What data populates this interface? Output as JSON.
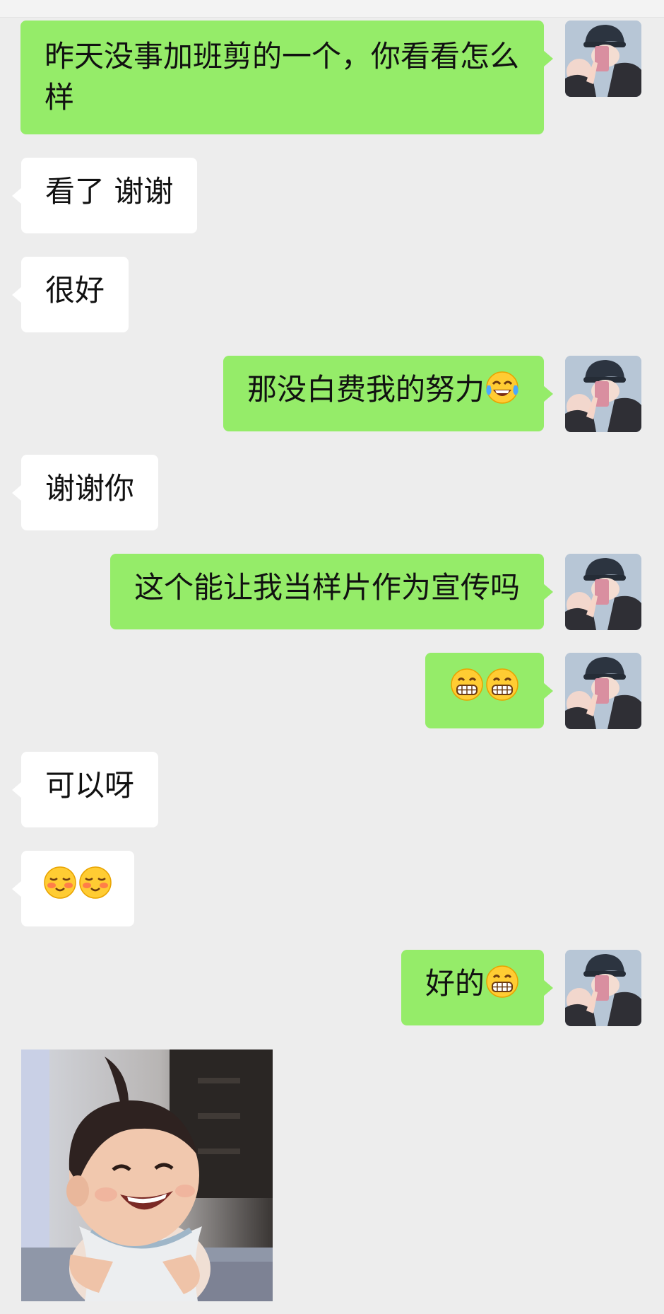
{
  "chat": {
    "messages": [
      {
        "id": "m1",
        "sender": "me",
        "text": "昨天没事加班剪的一个，你看看怎么样"
      },
      {
        "id": "m2",
        "sender": "contact",
        "text": "看了 谢谢"
      },
      {
        "id": "m3",
        "sender": "contact",
        "text": "很好"
      },
      {
        "id": "m4",
        "sender": "me",
        "text": "那没白费我的努力",
        "emoji": [
          "tears-of-joy-emoji"
        ]
      },
      {
        "id": "m5",
        "sender": "contact",
        "text": "谢谢你"
      },
      {
        "id": "m6",
        "sender": "me",
        "text": "这个能让我当样片作为宣传吗"
      },
      {
        "id": "m7",
        "sender": "me",
        "text": "",
        "emoji": [
          "grin-emoji",
          "grin-emoji"
        ]
      },
      {
        "id": "m8",
        "sender": "contact",
        "text": "可以呀"
      },
      {
        "id": "m9",
        "sender": "contact",
        "text": "",
        "emoji": [
          "blushing-smile-emoji",
          "blushing-smile-emoji"
        ]
      },
      {
        "id": "m10",
        "sender": "me",
        "text": "好的",
        "emoji": [
          "grin-emoji"
        ]
      },
      {
        "id": "m11",
        "sender": "contact",
        "type": "image",
        "image": "laughing-baby-photo"
      }
    ]
  },
  "colors": {
    "background": "#ededed",
    "my_bubble": "#95ec69",
    "their_bubble": "#ffffff",
    "text": "#111111"
  }
}
